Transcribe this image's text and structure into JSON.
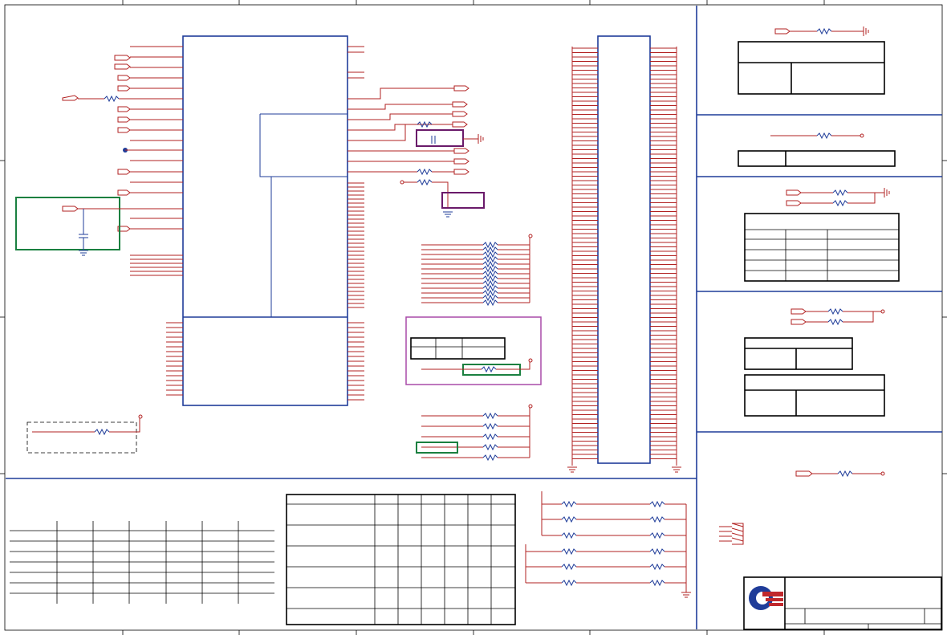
{
  "colors": {
    "wire": "#b22222",
    "border": "#1f3c99",
    "highlight_green": "#1a8040",
    "highlight_purple": "#6a1a6a",
    "logo_blue": "#1f3c99",
    "logo_red": "#c0282d"
  },
  "icons": {
    "logo": "company-logo-icon",
    "ground": "ground-symbol-icon",
    "power": "power-rail-icon"
  }
}
